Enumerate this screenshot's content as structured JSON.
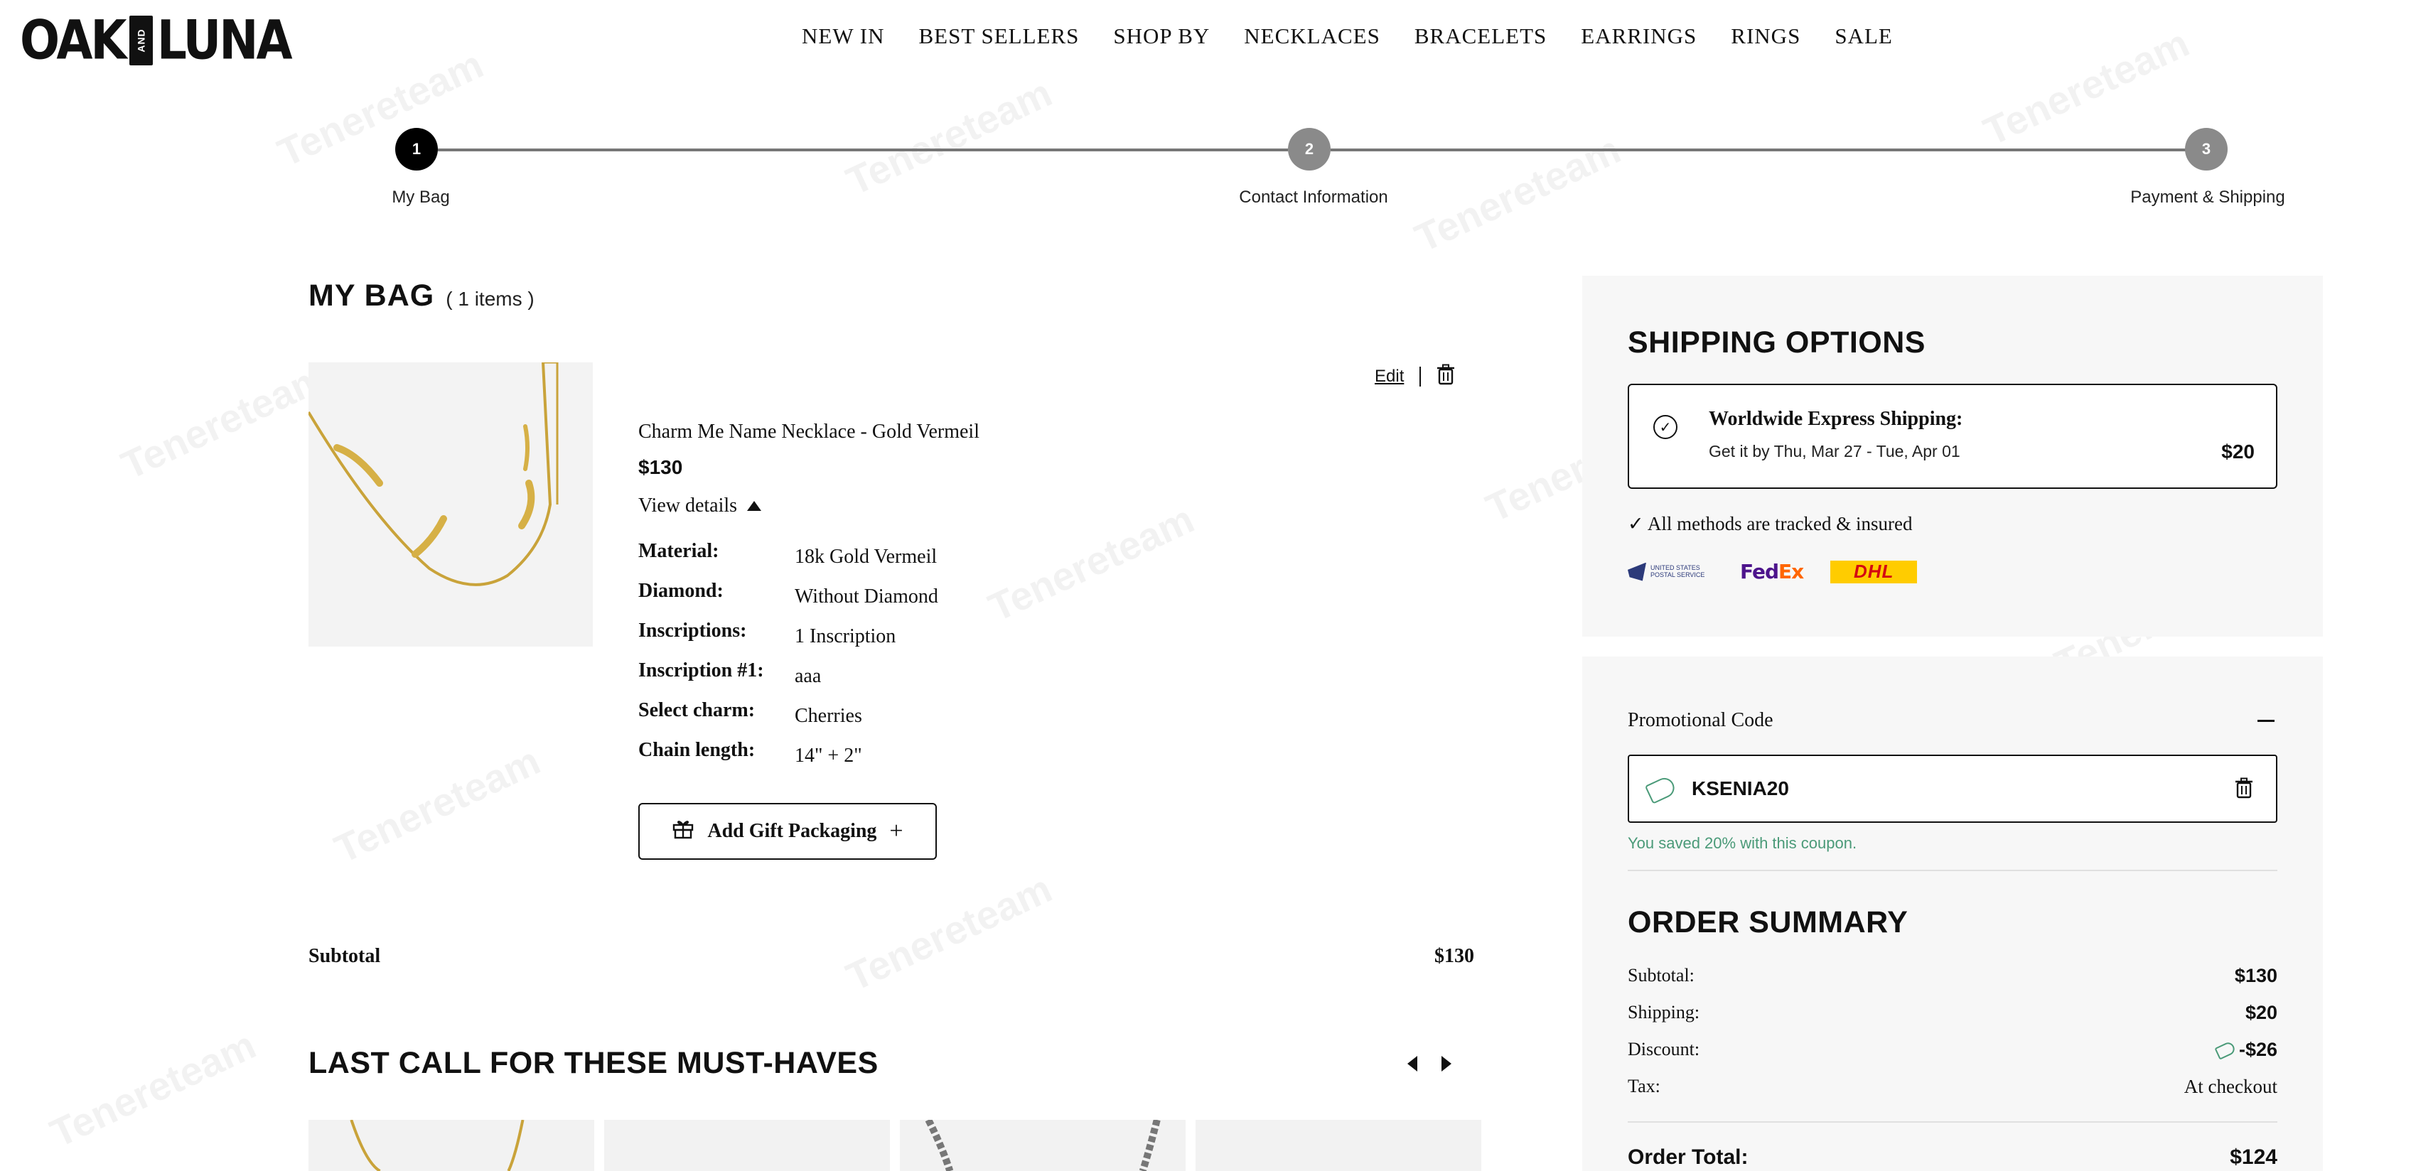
{
  "brand": {
    "left": "OAK",
    "and": "AND",
    "right": "LUNA"
  },
  "nav": {
    "items": [
      "NEW IN",
      "BEST SELLERS",
      "SHOP BY",
      "NECKLACES",
      "BRACELETS",
      "EARRINGS",
      "RINGS",
      "SALE"
    ]
  },
  "stepper": {
    "steps": [
      {
        "number": "1",
        "label": "My Bag",
        "state": "active"
      },
      {
        "number": "2",
        "label": "Contact Information",
        "state": "inactive"
      },
      {
        "number": "3",
        "label": "Payment & Shipping",
        "state": "inactive"
      }
    ]
  },
  "bag": {
    "title": "MY BAG",
    "count": "( 1 items )",
    "edit_label": "Edit",
    "item": {
      "name": "Charm Me Name Necklace - Gold Vermeil",
      "price": "$130",
      "view_details": "View details",
      "details": [
        {
          "key": "Material:",
          "value": "18k Gold Vermeil"
        },
        {
          "key": "Diamond:",
          "value": "Without Diamond"
        },
        {
          "key": "Inscriptions:",
          "value": "1 Inscription"
        },
        {
          "key": "Inscription #1:",
          "value": "aaa"
        },
        {
          "key": "Select charm:",
          "value": "Cherries"
        },
        {
          "key": "Chain length:",
          "value": "14\" + 2\""
        }
      ]
    },
    "gift_label": "Add Gift Packaging",
    "subtotal_label": "Subtotal",
    "subtotal_value": "$130"
  },
  "last_call": {
    "title": "LAST CALL FOR THESE MUST-HAVES"
  },
  "shipping": {
    "title": "SHIPPING OPTIONS",
    "option_title": "Worldwide Express Shipping:",
    "option_sub": "Get it by Thu, Mar 27 - Tue, Apr 01",
    "option_price": "$20",
    "tracked": "✓ All methods are tracked & insured",
    "carriers": {
      "usps_text": "UNITED STATES POSTAL SERVICE",
      "fedex_fed": "Fed",
      "fedex_ex": "Ex",
      "dhl": "DHL"
    }
  },
  "promo": {
    "header": "Promotional Code",
    "code": "KSENIA20",
    "saved_text": "You saved 20% with this coupon."
  },
  "summary": {
    "title": "ORDER SUMMARY",
    "rows": [
      {
        "key": "Subtotal:",
        "value": "$130"
      },
      {
        "key": "Shipping:",
        "value": "$20"
      },
      {
        "key": "Discount:",
        "value": "-$26"
      },
      {
        "key": "Tax:",
        "value": "At checkout"
      }
    ],
    "total_label": "Order Total:",
    "total_value": "$124"
  },
  "watermark_text": "Tenereteam",
  "colors": {
    "accent_green": "#4a9a78",
    "panel_bg": "#f7f7f7",
    "step_active": "#000000",
    "step_inactive": "#8a8a8a"
  }
}
